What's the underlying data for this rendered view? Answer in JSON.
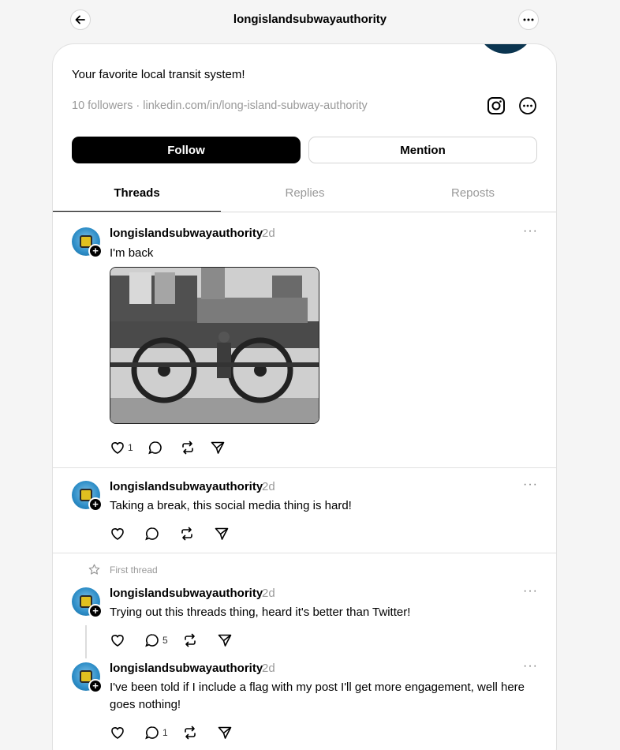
{
  "header": {
    "title": "longislandsubwayauthority"
  },
  "profile": {
    "bio": "Your favorite local transit system!",
    "followers": "10 followers",
    "separator": "·",
    "link": "linkedin.com/in/long-island-subway-authority",
    "follow_label": "Follow",
    "mention_label": "Mention"
  },
  "tabs": [
    {
      "label": "Threads"
    },
    {
      "label": "Replies"
    },
    {
      "label": "Reposts"
    }
  ],
  "posts": [
    {
      "user": "longislandsubwayauthority",
      "time": "2d",
      "text": "I'm back",
      "likes": "1",
      "replies": ""
    },
    {
      "user": "longislandsubwayauthority",
      "time": "2d",
      "text": "Taking a break, this social media thing is hard!",
      "likes": "",
      "replies": ""
    },
    {
      "user": "longislandsubwayauthority",
      "time": "2d",
      "text": "Trying out this threads thing, heard it's better than Twitter!",
      "likes": "",
      "replies": "5"
    },
    {
      "user": "longislandsubwayauthority",
      "time": "2d",
      "text": "I've been told if I include a flag with my post I'll get more engagement, well here goes nothing!",
      "likes": "",
      "replies": "1"
    }
  ],
  "first_thread_label": "First thread",
  "icons": {
    "back": "arrow-left-icon",
    "more": "ellipsis-icon",
    "instagram": "instagram-icon",
    "like": "heart-icon",
    "reply": "comment-icon",
    "repost": "repost-icon",
    "share": "send-icon",
    "pin": "star-icon"
  }
}
